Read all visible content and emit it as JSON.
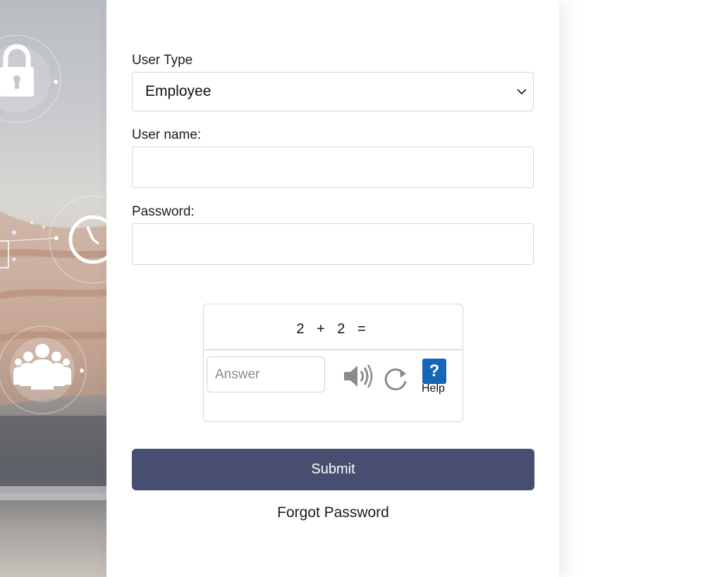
{
  "form": {
    "user_type_label": "User Type",
    "user_type_value": "Employee",
    "username_label": "User name:",
    "username_value": "",
    "password_label": "Password:",
    "password_value": "",
    "submit_label": "Submit",
    "forgot_label": "Forgot Password"
  },
  "captcha": {
    "question": "2 + 2 =",
    "answer_placeholder": "Answer",
    "help_symbol": "?",
    "help_label": "Help",
    "audio_icon": "speaker-icon",
    "refresh_icon": "refresh-icon"
  },
  "colors": {
    "submit_bg": "#474e70",
    "help_bg": "#1666b8"
  }
}
